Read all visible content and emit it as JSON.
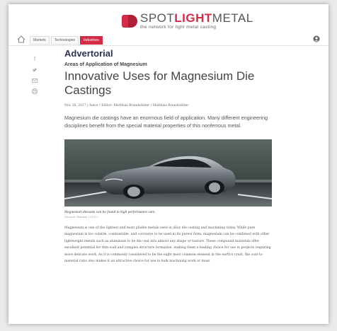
{
  "brand": {
    "word_part1": "SPOT",
    "word_part2": "LIGHT",
    "word_part3": "METAL",
    "tagline": "the network for light metal casting",
    "accent_color": "#d42c47"
  },
  "nav": {
    "items": [
      {
        "label": "Markets",
        "active": false
      },
      {
        "label": "Technologies",
        "active": false
      },
      {
        "label": "Industries",
        "active": true
      }
    ]
  },
  "share": [
    "facebook-icon",
    "twitter-icon",
    "email-icon",
    "print-icon"
  ],
  "article": {
    "kicker": "Advertorial",
    "subkicker": "Areas of Application of Magnesium",
    "title": "Innovative Uses for Magnesium Die Castings",
    "byline": "Nov 26, 2017 | Autor / Editor: Matthias Brandstätter / Matthias Brandstätter",
    "lead": "Magnesium die castings have an enormous field of application. Many different engineering disciplines benefit from the special material properties of this nonferrous metal.",
    "caption": "Magnesium diecasts can be found in high performance cars.",
    "source": "(Source: Pixabay / CC0 )",
    "body": "Magnesium is one of the lightest and most pliable metals used in alloy die casting and machining today. While pure magnesium is too volatile, combustible, and corrosive to be used in its purest form, magnesium can be combined with other lightweight metals such as aluminum to be die cast into almost any shape or texture. These compound materials offer excellent potential for thin-wall and complex structure formation, making them a leading choice for use in projects requiring more delicate work. As it is commonly considered to be the eight most common element in the earth's crust, the cost-to-material ratio also makes it an attractive choice for use in bulk machining work or mass"
  }
}
